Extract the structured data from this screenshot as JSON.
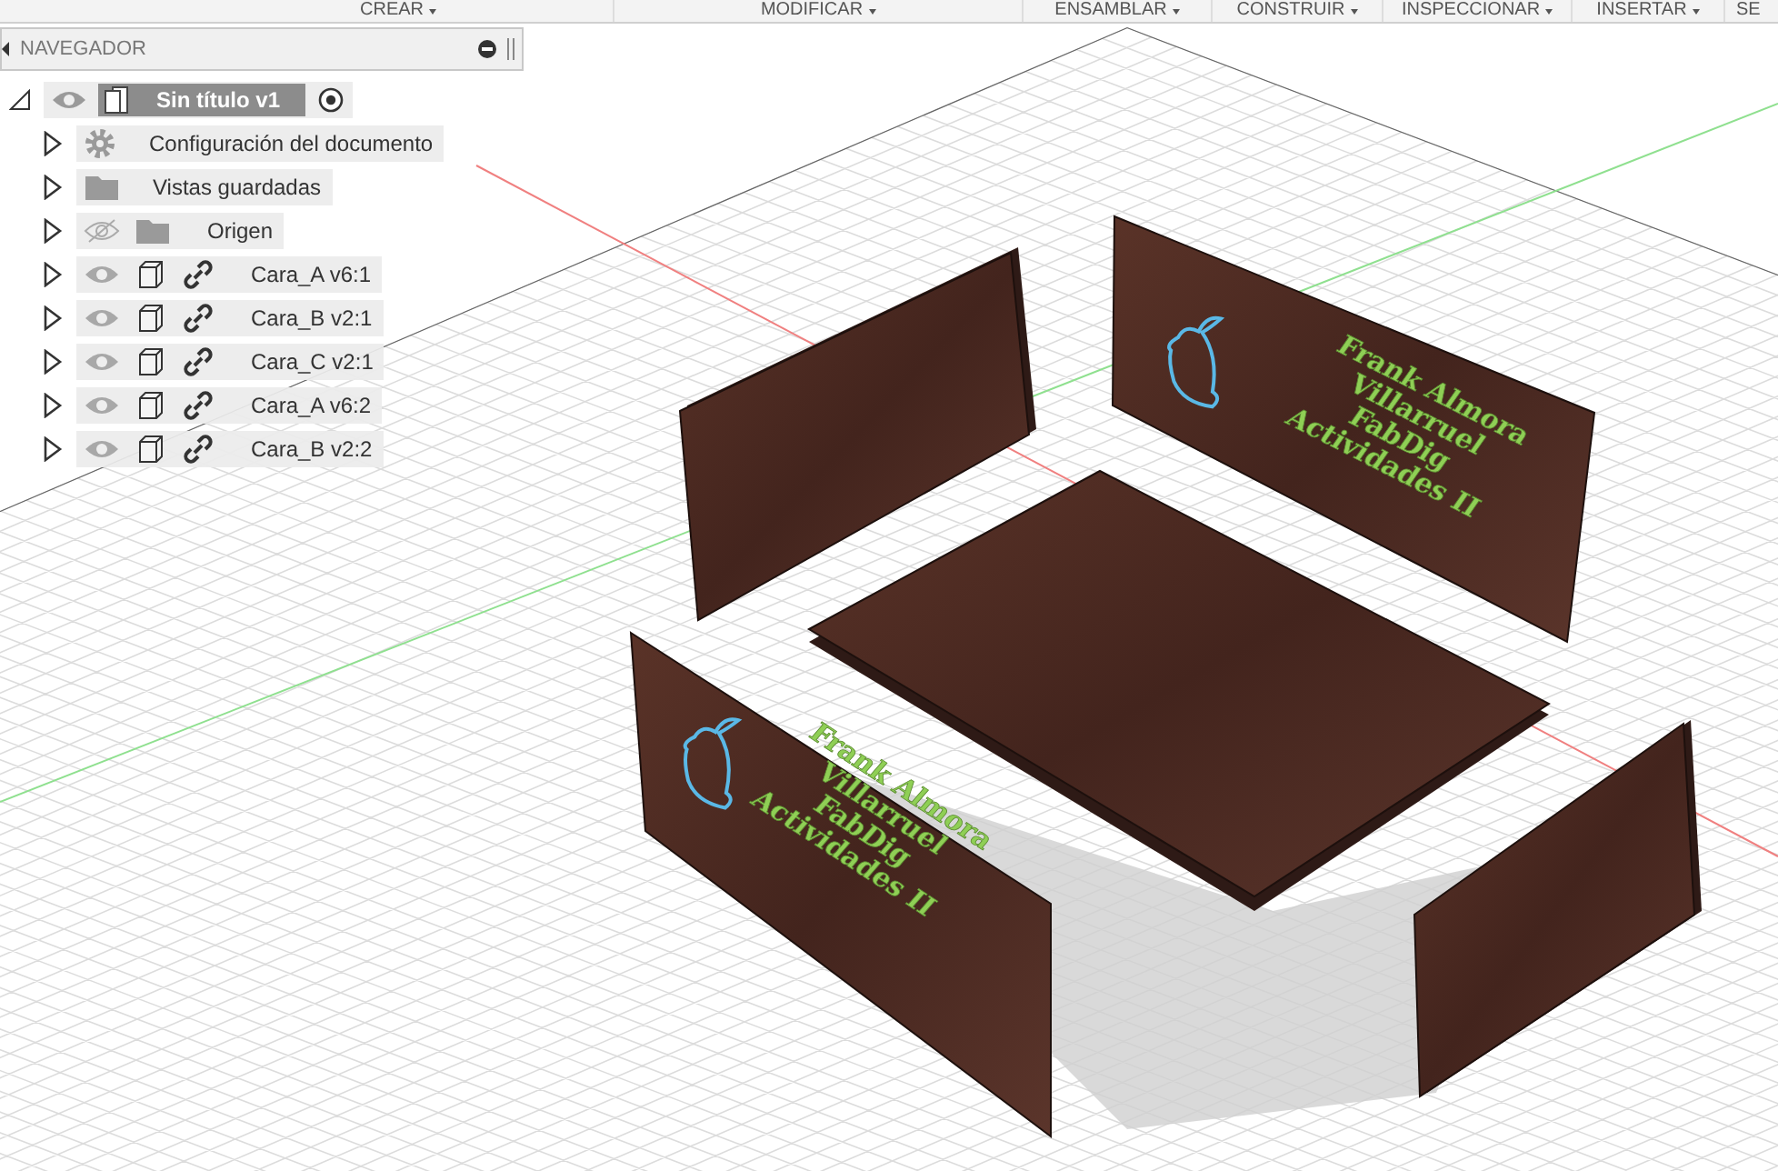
{
  "toolbar": [
    {
      "label": "CREAR",
      "dropdown": true
    },
    {
      "label": "MODIFICAR",
      "dropdown": true
    },
    {
      "label": "ENSAMBLAR",
      "dropdown": true
    },
    {
      "label": "CONSTRUIR",
      "dropdown": true
    },
    {
      "label": "INSPECCIONAR",
      "dropdown": true
    },
    {
      "label": "INSERTAR",
      "dropdown": true
    },
    {
      "label": "SE",
      "dropdown": false
    }
  ],
  "navigator": {
    "title": "NAVEGADOR"
  },
  "tree": {
    "name": "Sin título v1",
    "expanded": true,
    "selected": true,
    "visible": true,
    "children": [
      {
        "kind": "settings",
        "name": "Configuración del documento",
        "expanded": false
      },
      {
        "kind": "folder",
        "name": "Vistas guardadas",
        "expanded": false
      },
      {
        "kind": "origin",
        "name": "Origen",
        "expanded": false,
        "visible": false
      },
      {
        "kind": "component",
        "name": "Cara_A v6:1",
        "expanded": false,
        "visible": true
      },
      {
        "kind": "component",
        "name": "Cara_B v2:1",
        "expanded": false,
        "visible": true
      },
      {
        "kind": "component",
        "name": "Cara_C v2:1",
        "expanded": false,
        "visible": true
      },
      {
        "kind": "component",
        "name": "Cara_A v6:2",
        "expanded": false,
        "visible": true
      },
      {
        "kind": "component",
        "name": "Cara_B v2:2",
        "expanded": false,
        "visible": true
      }
    ]
  },
  "model": {
    "engravings": [
      {
        "lines": [
          "Frank Almora",
          "Villarruel",
          "FabDig",
          "Actividades II"
        ]
      },
      {
        "lines": [
          "Frank Almora",
          "Villarruel",
          "FabDig",
          "Actividades II"
        ]
      }
    ]
  }
}
